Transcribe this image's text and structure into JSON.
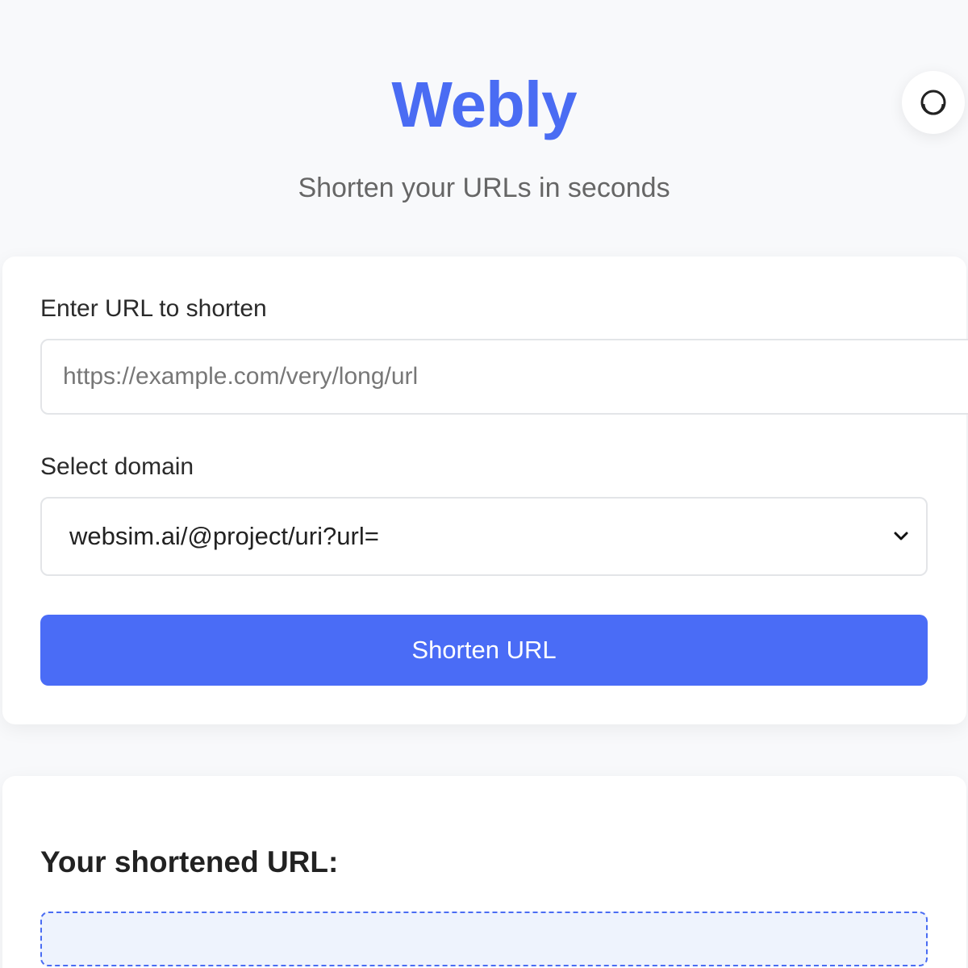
{
  "header": {
    "brand": "Webly",
    "tagline": "Shorten your URLs in seconds"
  },
  "theme_toggle": {
    "icon": "half-circle-icon"
  },
  "form": {
    "url_label": "Enter URL to shorten",
    "url_placeholder": "https://example.com/very/long/url",
    "url_value": "",
    "domain_label": "Select domain",
    "domain_selected": "websim.ai/@project/uri?url=",
    "submit_label": "Shorten URL"
  },
  "result": {
    "title": "Your shortened URL:",
    "value": ""
  },
  "colors": {
    "accent": "#4a6cf3",
    "button": "#4a6cf6",
    "background": "#f8f9fb",
    "result_bg": "#eef3fd"
  }
}
